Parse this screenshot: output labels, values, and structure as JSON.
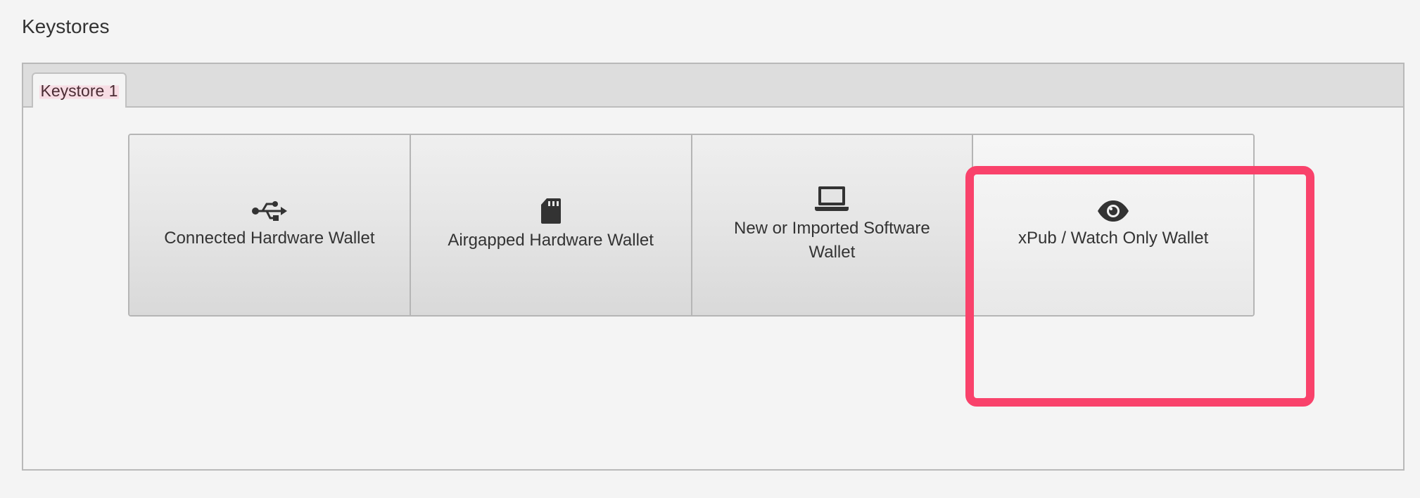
{
  "section": {
    "title": "Keystores"
  },
  "tabs": [
    {
      "label": "Keystore 1",
      "selected": true
    }
  ],
  "wallet_options": [
    {
      "label": "Connected Hardware Wallet",
      "icon": "usb-icon"
    },
    {
      "label": "Airgapped Hardware Wallet",
      "icon": "sd-card-icon"
    },
    {
      "label": "New or Imported Software Wallet",
      "icon": "laptop-icon"
    },
    {
      "label": "xPub / Watch Only Wallet",
      "icon": "eye-icon",
      "highlighted": true
    }
  ],
  "colors": {
    "highlight": "#f9426b",
    "background": "#f4f4f4",
    "tab_header": "#dddddd",
    "text": "#333333"
  }
}
